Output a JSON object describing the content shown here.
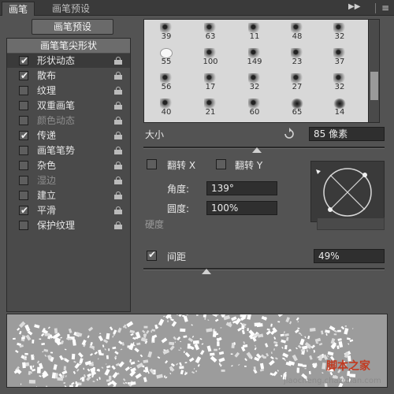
{
  "tabs": {
    "brush": "画笔",
    "brush_presets": "画笔预设"
  },
  "preset_button": "画笔预设",
  "options": [
    {
      "label": "画笔笔尖形状",
      "type": "header"
    },
    {
      "label": "形状动态",
      "checked": true,
      "lock": true,
      "selected": true
    },
    {
      "label": "散布",
      "checked": true,
      "lock": true
    },
    {
      "label": "纹理",
      "checked": false,
      "lock": true
    },
    {
      "label": "双重画笔",
      "checked": false,
      "lock": true
    },
    {
      "label": "颜色动态",
      "checked": false,
      "lock": true,
      "dim": true
    },
    {
      "label": "传递",
      "checked": true,
      "lock": true
    },
    {
      "label": "画笔笔势",
      "checked": false,
      "lock": true
    },
    {
      "label": "杂色",
      "checked": false,
      "lock": true
    },
    {
      "label": "湿边",
      "checked": false,
      "lock": true,
      "dim": true
    },
    {
      "label": "建立",
      "checked": false,
      "lock": true
    },
    {
      "label": "平滑",
      "checked": true,
      "lock": true
    },
    {
      "label": "保护纹理",
      "checked": false,
      "lock": true
    }
  ],
  "brush_sizes": [
    [
      "39",
      "63",
      "11",
      "48",
      "32"
    ],
    [
      "55",
      "100",
      "149",
      "23",
      "37"
    ],
    [
      "56",
      "17",
      "32",
      "27",
      "32"
    ],
    [
      "40",
      "21",
      "60",
      "65",
      "14"
    ]
  ],
  "size": {
    "label": "大小",
    "value": "85 像素",
    "slider": 0.47
  },
  "flip_x": {
    "label": "翻转 X",
    "checked": false
  },
  "flip_y": {
    "label": "翻转 Y",
    "checked": false
  },
  "angle": {
    "label": "角度:",
    "value": "139°"
  },
  "roundness": {
    "label": "圆度:",
    "value": "100%"
  },
  "hardness": {
    "label": "硬度"
  },
  "spacing": {
    "label": "间距",
    "value": "49%",
    "checked": true,
    "slider": 0.26
  },
  "watermark": {
    "brand": "脚本之家",
    "site": "jiaocheng.chazidian.com"
  },
  "colors": {
    "panel": "#535353",
    "dark": "#2f2f2f",
    "grid_bg": "#d8d8d8",
    "accent": "#c23a20"
  },
  "icons": {
    "menu": "menu-icon",
    "expand": "double-arrow-icon",
    "reset": "reset-size-icon",
    "lock": "lock-icon"
  }
}
